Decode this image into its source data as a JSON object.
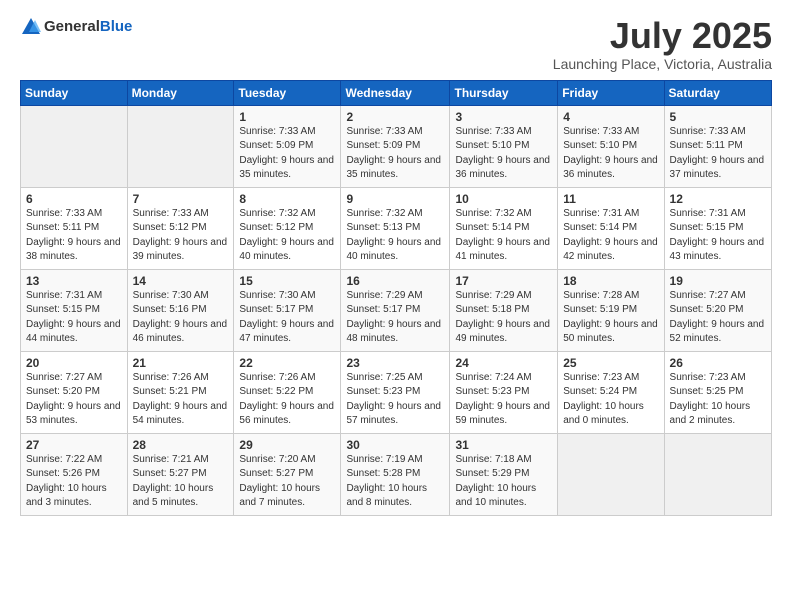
{
  "logo": {
    "text_general": "General",
    "text_blue": "Blue"
  },
  "title": "July 2025",
  "subtitle": "Launching Place, Victoria, Australia",
  "days_of_week": [
    "Sunday",
    "Monday",
    "Tuesday",
    "Wednesday",
    "Thursday",
    "Friday",
    "Saturday"
  ],
  "weeks": [
    [
      {
        "day": "",
        "sunrise": "",
        "sunset": "",
        "daylight": "",
        "empty": true
      },
      {
        "day": "",
        "sunrise": "",
        "sunset": "",
        "daylight": "",
        "empty": true
      },
      {
        "day": "1",
        "sunrise": "Sunrise: 7:33 AM",
        "sunset": "Sunset: 5:09 PM",
        "daylight": "Daylight: 9 hours and 35 minutes."
      },
      {
        "day": "2",
        "sunrise": "Sunrise: 7:33 AM",
        "sunset": "Sunset: 5:09 PM",
        "daylight": "Daylight: 9 hours and 35 minutes."
      },
      {
        "day": "3",
        "sunrise": "Sunrise: 7:33 AM",
        "sunset": "Sunset: 5:10 PM",
        "daylight": "Daylight: 9 hours and 36 minutes."
      },
      {
        "day": "4",
        "sunrise": "Sunrise: 7:33 AM",
        "sunset": "Sunset: 5:10 PM",
        "daylight": "Daylight: 9 hours and 36 minutes."
      },
      {
        "day": "5",
        "sunrise": "Sunrise: 7:33 AM",
        "sunset": "Sunset: 5:11 PM",
        "daylight": "Daylight: 9 hours and 37 minutes."
      }
    ],
    [
      {
        "day": "6",
        "sunrise": "Sunrise: 7:33 AM",
        "sunset": "Sunset: 5:11 PM",
        "daylight": "Daylight: 9 hours and 38 minutes."
      },
      {
        "day": "7",
        "sunrise": "Sunrise: 7:33 AM",
        "sunset": "Sunset: 5:12 PM",
        "daylight": "Daylight: 9 hours and 39 minutes."
      },
      {
        "day": "8",
        "sunrise": "Sunrise: 7:32 AM",
        "sunset": "Sunset: 5:12 PM",
        "daylight": "Daylight: 9 hours and 40 minutes."
      },
      {
        "day": "9",
        "sunrise": "Sunrise: 7:32 AM",
        "sunset": "Sunset: 5:13 PM",
        "daylight": "Daylight: 9 hours and 40 minutes."
      },
      {
        "day": "10",
        "sunrise": "Sunrise: 7:32 AM",
        "sunset": "Sunset: 5:14 PM",
        "daylight": "Daylight: 9 hours and 41 minutes."
      },
      {
        "day": "11",
        "sunrise": "Sunrise: 7:31 AM",
        "sunset": "Sunset: 5:14 PM",
        "daylight": "Daylight: 9 hours and 42 minutes."
      },
      {
        "day": "12",
        "sunrise": "Sunrise: 7:31 AM",
        "sunset": "Sunset: 5:15 PM",
        "daylight": "Daylight: 9 hours and 43 minutes."
      }
    ],
    [
      {
        "day": "13",
        "sunrise": "Sunrise: 7:31 AM",
        "sunset": "Sunset: 5:15 PM",
        "daylight": "Daylight: 9 hours and 44 minutes."
      },
      {
        "day": "14",
        "sunrise": "Sunrise: 7:30 AM",
        "sunset": "Sunset: 5:16 PM",
        "daylight": "Daylight: 9 hours and 46 minutes."
      },
      {
        "day": "15",
        "sunrise": "Sunrise: 7:30 AM",
        "sunset": "Sunset: 5:17 PM",
        "daylight": "Daylight: 9 hours and 47 minutes."
      },
      {
        "day": "16",
        "sunrise": "Sunrise: 7:29 AM",
        "sunset": "Sunset: 5:17 PM",
        "daylight": "Daylight: 9 hours and 48 minutes."
      },
      {
        "day": "17",
        "sunrise": "Sunrise: 7:29 AM",
        "sunset": "Sunset: 5:18 PM",
        "daylight": "Daylight: 9 hours and 49 minutes."
      },
      {
        "day": "18",
        "sunrise": "Sunrise: 7:28 AM",
        "sunset": "Sunset: 5:19 PM",
        "daylight": "Daylight: 9 hours and 50 minutes."
      },
      {
        "day": "19",
        "sunrise": "Sunrise: 7:27 AM",
        "sunset": "Sunset: 5:20 PM",
        "daylight": "Daylight: 9 hours and 52 minutes."
      }
    ],
    [
      {
        "day": "20",
        "sunrise": "Sunrise: 7:27 AM",
        "sunset": "Sunset: 5:20 PM",
        "daylight": "Daylight: 9 hours and 53 minutes."
      },
      {
        "day": "21",
        "sunrise": "Sunrise: 7:26 AM",
        "sunset": "Sunset: 5:21 PM",
        "daylight": "Daylight: 9 hours and 54 minutes."
      },
      {
        "day": "22",
        "sunrise": "Sunrise: 7:26 AM",
        "sunset": "Sunset: 5:22 PM",
        "daylight": "Daylight: 9 hours and 56 minutes."
      },
      {
        "day": "23",
        "sunrise": "Sunrise: 7:25 AM",
        "sunset": "Sunset: 5:23 PM",
        "daylight": "Daylight: 9 hours and 57 minutes."
      },
      {
        "day": "24",
        "sunrise": "Sunrise: 7:24 AM",
        "sunset": "Sunset: 5:23 PM",
        "daylight": "Daylight: 9 hours and 59 minutes."
      },
      {
        "day": "25",
        "sunrise": "Sunrise: 7:23 AM",
        "sunset": "Sunset: 5:24 PM",
        "daylight": "Daylight: 10 hours and 0 minutes."
      },
      {
        "day": "26",
        "sunrise": "Sunrise: 7:23 AM",
        "sunset": "Sunset: 5:25 PM",
        "daylight": "Daylight: 10 hours and 2 minutes."
      }
    ],
    [
      {
        "day": "27",
        "sunrise": "Sunrise: 7:22 AM",
        "sunset": "Sunset: 5:26 PM",
        "daylight": "Daylight: 10 hours and 3 minutes."
      },
      {
        "day": "28",
        "sunrise": "Sunrise: 7:21 AM",
        "sunset": "Sunset: 5:27 PM",
        "daylight": "Daylight: 10 hours and 5 minutes."
      },
      {
        "day": "29",
        "sunrise": "Sunrise: 7:20 AM",
        "sunset": "Sunset: 5:27 PM",
        "daylight": "Daylight: 10 hours and 7 minutes."
      },
      {
        "day": "30",
        "sunrise": "Sunrise: 7:19 AM",
        "sunset": "Sunset: 5:28 PM",
        "daylight": "Daylight: 10 hours and 8 minutes."
      },
      {
        "day": "31",
        "sunrise": "Sunrise: 7:18 AM",
        "sunset": "Sunset: 5:29 PM",
        "daylight": "Daylight: 10 hours and 10 minutes."
      },
      {
        "day": "",
        "sunrise": "",
        "sunset": "",
        "daylight": "",
        "empty": true
      },
      {
        "day": "",
        "sunrise": "",
        "sunset": "",
        "daylight": "",
        "empty": true
      }
    ]
  ]
}
